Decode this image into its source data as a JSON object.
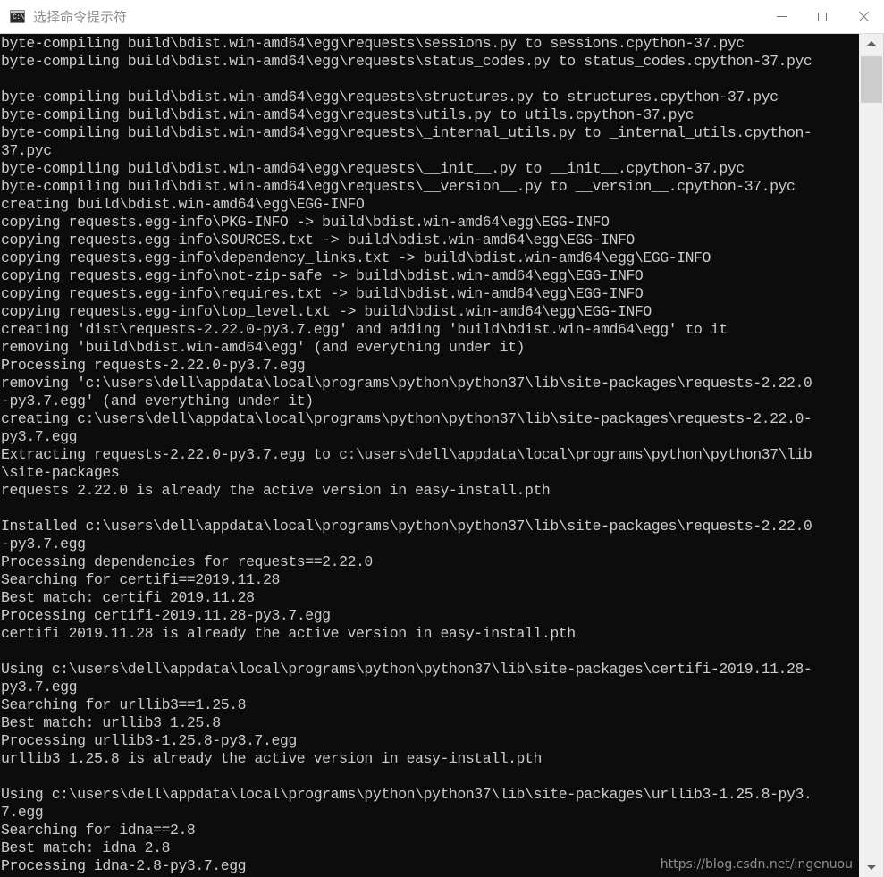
{
  "window": {
    "title": "选择命令提示符",
    "icon": "cmd-prompt-icon",
    "icon_label": "C:\\.",
    "controls": {
      "minimize": "—",
      "maximize": "□",
      "close": "✕"
    }
  },
  "colors": {
    "console_background": "#0c0c0c",
    "console_foreground": "#cccccc",
    "titlebar_background": "#ffffff",
    "titlebar_text": "#8d8d8d",
    "scrollbar_track": "#f0f0f0",
    "scrollbar_thumb": "#cdcdcd"
  },
  "console": {
    "lines": [
      "byte-compiling build\\bdist.win-amd64\\egg\\requests\\sessions.py to sessions.cpython-37.pyc",
      "byte-compiling build\\bdist.win-amd64\\egg\\requests\\status_codes.py to status_codes.cpython-37.pyc",
      "",
      "byte-compiling build\\bdist.win-amd64\\egg\\requests\\structures.py to structures.cpython-37.pyc",
      "byte-compiling build\\bdist.win-amd64\\egg\\requests\\utils.py to utils.cpython-37.pyc",
      "byte-compiling build\\bdist.win-amd64\\egg\\requests\\_internal_utils.py to _internal_utils.cpython-",
      "37.pyc",
      "byte-compiling build\\bdist.win-amd64\\egg\\requests\\__init__.py to __init__.cpython-37.pyc",
      "byte-compiling build\\bdist.win-amd64\\egg\\requests\\__version__.py to __version__.cpython-37.pyc",
      "creating build\\bdist.win-amd64\\egg\\EGG-INFO",
      "copying requests.egg-info\\PKG-INFO -> build\\bdist.win-amd64\\egg\\EGG-INFO",
      "copying requests.egg-info\\SOURCES.txt -> build\\bdist.win-amd64\\egg\\EGG-INFO",
      "copying requests.egg-info\\dependency_links.txt -> build\\bdist.win-amd64\\egg\\EGG-INFO",
      "copying requests.egg-info\\not-zip-safe -> build\\bdist.win-amd64\\egg\\EGG-INFO",
      "copying requests.egg-info\\requires.txt -> build\\bdist.win-amd64\\egg\\EGG-INFO",
      "copying requests.egg-info\\top_level.txt -> build\\bdist.win-amd64\\egg\\EGG-INFO",
      "creating 'dist\\requests-2.22.0-py3.7.egg' and adding 'build\\bdist.win-amd64\\egg' to it",
      "removing 'build\\bdist.win-amd64\\egg' (and everything under it)",
      "Processing requests-2.22.0-py3.7.egg",
      "removing 'c:\\users\\dell\\appdata\\local\\programs\\python\\python37\\lib\\site-packages\\requests-2.22.0",
      "-py3.7.egg' (and everything under it)",
      "creating c:\\users\\dell\\appdata\\local\\programs\\python\\python37\\lib\\site-packages\\requests-2.22.0-",
      "py3.7.egg",
      "Extracting requests-2.22.0-py3.7.egg to c:\\users\\dell\\appdata\\local\\programs\\python\\python37\\lib",
      "\\site-packages",
      "requests 2.22.0 is already the active version in easy-install.pth",
      "",
      "Installed c:\\users\\dell\\appdata\\local\\programs\\python\\python37\\lib\\site-packages\\requests-2.22.0",
      "-py3.7.egg",
      "Processing dependencies for requests==2.22.0",
      "Searching for certifi==2019.11.28",
      "Best match: certifi 2019.11.28",
      "Processing certifi-2019.11.28-py3.7.egg",
      "certifi 2019.11.28 is already the active version in easy-install.pth",
      "",
      "Using c:\\users\\dell\\appdata\\local\\programs\\python\\python37\\lib\\site-packages\\certifi-2019.11.28-",
      "py3.7.egg",
      "Searching for urllib3==1.25.8",
      "Best match: urllib3 1.25.8",
      "Processing urllib3-1.25.8-py3.7.egg",
      "urllib3 1.25.8 is already the active version in easy-install.pth",
      "",
      "Using c:\\users\\dell\\appdata\\local\\programs\\python\\python37\\lib\\site-packages\\urllib3-1.25.8-py3.",
      "7.egg",
      "Searching for idna==2.8",
      "Best match: idna 2.8",
      "Processing idna-2.8-py3.7.egg"
    ]
  },
  "watermark": {
    "text": "https://blog.csdn.net/ingenuou"
  },
  "scrollbar": {
    "up_arrow": "scroll-up",
    "down_arrow": "scroll-down",
    "thumb": "scroll-thumb"
  }
}
